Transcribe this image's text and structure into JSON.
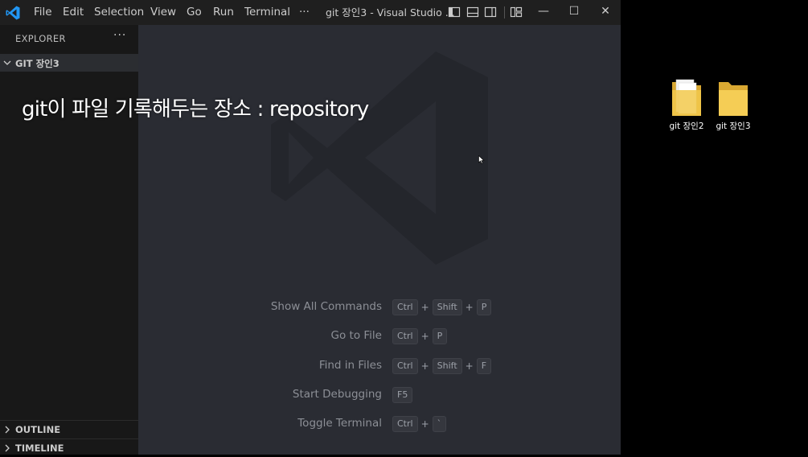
{
  "window": {
    "title": "git 장인3 - Visual Studio ...",
    "menu": [
      "File",
      "Edit",
      "Selection",
      "View",
      "Go",
      "Run",
      "Terminal",
      "···"
    ],
    "controls": {
      "minimize": "—",
      "maximize": "☐",
      "close": "✕"
    }
  },
  "sidebar": {
    "title": "EXPLORER",
    "more": "···",
    "repo_section": "GIT 장인3",
    "outline_section": "OUTLINE",
    "timeline_section": "TIMELINE"
  },
  "editor": {
    "shortcuts": [
      {
        "label": "Show All Commands",
        "keys": [
          "Ctrl",
          "Shift",
          "P"
        ]
      },
      {
        "label": "Go to File",
        "keys": [
          "Ctrl",
          "P"
        ]
      },
      {
        "label": "Find in Files",
        "keys": [
          "Ctrl",
          "Shift",
          "F"
        ]
      },
      {
        "label": "Start Debugging",
        "keys": [
          "F5"
        ]
      },
      {
        "label": "Toggle Terminal",
        "keys": [
          "Ctrl",
          "`"
        ]
      }
    ]
  },
  "overlay": {
    "caption": "git이 파일 기록해두는 장소 : repository"
  },
  "desktop": {
    "icons": [
      {
        "label": "git 장인2"
      },
      {
        "label": "git 장인3"
      }
    ]
  },
  "colors": {
    "accent": "#0078d4",
    "editor_bg": "#2a2c33",
    "sidebar_bg": "#181818",
    "folder": "#f0c24a"
  },
  "icon_names": [
    "vscode-logo-icon",
    "layout-sidebar-left-icon",
    "layout-panel-icon",
    "layout-sidebar-right-icon",
    "customize-layout-icon",
    "folder-icon"
  ]
}
